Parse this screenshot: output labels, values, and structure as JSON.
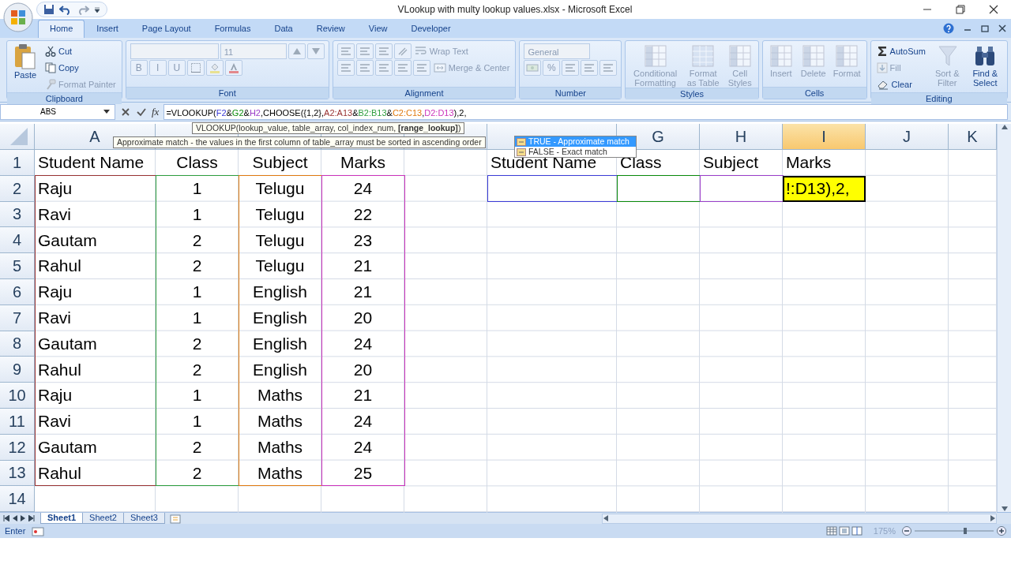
{
  "window": {
    "title": "VLookup with  multy lookup values.xlsx - Microsoft Excel"
  },
  "ribbon_tabs": [
    {
      "label": "Home",
      "selected": true
    },
    {
      "label": "Insert",
      "selected": false
    },
    {
      "label": "Page Layout",
      "selected": false
    },
    {
      "label": "Formulas",
      "selected": false
    },
    {
      "label": "Data",
      "selected": false
    },
    {
      "label": "Review",
      "selected": false
    },
    {
      "label": "View",
      "selected": false
    },
    {
      "label": "Developer",
      "selected": false
    }
  ],
  "ribbon": {
    "groups": [
      {
        "label": "Clipboard",
        "blocks": [
          {
            "kind": "large",
            "label": "Paste",
            "disabled": false
          },
          {
            "kind": "stack",
            "lines": [
              [
                {
                  "kind": "small",
                  "label": "Cut",
                  "disabled": false
                }
              ],
              [
                {
                  "kind": "small",
                  "label": "Copy",
                  "disabled": false
                }
              ],
              [
                {
                  "kind": "small",
                  "label": "Format Painter",
                  "disabled": true
                }
              ]
            ]
          }
        ]
      },
      {
        "label": "Font",
        "blocks": [
          {
            "kind": "stack",
            "lines": [
              [
                {
                  "kind": "field",
                  "disabled": true
                },
                {
                  "kind": "field",
                  "value": "11",
                  "disabled": true
                },
                {
                  "kind": "icon_button",
                  "disabled": true
                },
                {
                  "kind": "icon_button",
                  "disabled": true
                }
              ],
              [
                {
                  "kind": "text_button",
                  "label": "B",
                  "disabled": true
                },
                {
                  "kind": "text_button",
                  "label": "I",
                  "disabled": true
                },
                {
                  "kind": "text_button",
                  "label": "U",
                  "disabled": true
                },
                {
                  "kind": "icon_button",
                  "disabled": true
                },
                {
                  "kind": "icon_button",
                  "disabled": true
                },
                {
                  "kind": "icon_button",
                  "disabled": true
                }
              ]
            ]
          }
        ]
      },
      {
        "label": "Alignment",
        "blocks": [
          {
            "kind": "stack",
            "lines": [
              [
                {
                  "kind": "icon_button",
                  "disabled": true
                },
                {
                  "kind": "icon_button",
                  "disabled": true
                },
                {
                  "kind": "icon_button",
                  "disabled": true
                },
                {
                  "kind": "icon_button",
                  "disabled": true
                },
                {
                  "kind": "small",
                  "label": "Wrap Text",
                  "disabled": true
                }
              ],
              [
                {
                  "kind": "icon_button",
                  "disabled": true
                },
                {
                  "kind": "icon_button",
                  "disabled": true
                },
                {
                  "kind": "icon_button",
                  "disabled": true
                },
                {
                  "kind": "icon_button",
                  "disabled": true
                },
                {
                  "kind": "icon_button",
                  "disabled": true
                },
                {
                  "kind": "small",
                  "label": "Merge & Center",
                  "disabled": true
                }
              ]
            ]
          }
        ]
      },
      {
        "label": "Number",
        "blocks": [
          {
            "kind": "stack",
            "lines": [
              [
                {
                  "kind": "field",
                  "value": "General",
                  "disabled": true
                }
              ],
              [
                {
                  "kind": "icon_button",
                  "disabled": true
                },
                {
                  "kind": "text_button",
                  "label": "%",
                  "disabled": true
                },
                {
                  "kind": "icon_button",
                  "disabled": true
                },
                {
                  "kind": "icon_button",
                  "disabled": true
                },
                {
                  "kind": "icon_button",
                  "disabled": true
                }
              ]
            ]
          }
        ]
      },
      {
        "label": "Styles",
        "blocks": [
          {
            "kind": "large",
            "label": "Conditional Formatting",
            "disabled": true
          },
          {
            "kind": "large",
            "label": "Format as Table",
            "disabled": true
          },
          {
            "kind": "large",
            "label": "Cell Styles",
            "disabled": true
          }
        ]
      },
      {
        "label": "Cells",
        "blocks": [
          {
            "kind": "large",
            "label": "Insert",
            "disabled": true
          },
          {
            "kind": "large",
            "label": "Delete",
            "disabled": true
          },
          {
            "kind": "large",
            "label": "Format",
            "disabled": true
          }
        ]
      },
      {
        "label": "Editing",
        "blocks": [
          {
            "kind": "stack",
            "lines": [
              [
                {
                  "kind": "small",
                  "label": "AutoSum",
                  "disabled": false
                }
              ],
              [
                {
                  "kind": "small",
                  "label": "Fill",
                  "disabled": true
                }
              ],
              [
                {
                  "kind": "small",
                  "label": "Clear",
                  "disabled": false
                }
              ]
            ]
          },
          {
            "kind": "large",
            "label": "Sort & Filter",
            "disabled": true
          },
          {
            "kind": "large",
            "label": "Find & Select",
            "disabled": false
          }
        ]
      }
    ]
  },
  "formula_bar": {
    "name_box": "ABS",
    "function_label": "fx",
    "formula": [
      {
        "text": "=VLOOKUP("
      },
      {
        "text": "F2",
        "color": "#3c3cd6"
      },
      {
        "text": "&"
      },
      {
        "text": "G2",
        "color": "#0a8a0a"
      },
      {
        "text": "&"
      },
      {
        "text": "H2",
        "color": "#9b3fc9"
      },
      {
        "text": ",CHOOSE({1,2},"
      },
      {
        "text": "A2:A13",
        "color": "#993333"
      },
      {
        "text": "&"
      },
      {
        "text": "B2:B13",
        "color": "#2e9e3e"
      },
      {
        "text": "&"
      },
      {
        "text": "C2:C13",
        "color": "#e07a10"
      },
      {
        "text": ","
      },
      {
        "text": "D2:D13",
        "color": "#cc33bb"
      },
      {
        "text": "),2,"
      }
    ]
  },
  "function_tooltip": "VLOOKUP(lookup_value, table_array, col_index_num, **[range_lookup]**)",
  "argument_tooltip": "Approximate match - the values in the first column of table_array must be sorted in ascending order",
  "autocomplete": [
    {
      "label": "TRUE - Approximate match",
      "selected": true
    },
    {
      "label": "FALSE - Exact match",
      "selected": false
    }
  ],
  "column_headers": [
    {
      "label": "A",
      "selected": false
    },
    {
      "selected": false
    },
    {
      "selected": false
    },
    {
      "selected": false
    },
    {
      "selected": false
    },
    {
      "selected": false
    },
    {
      "label": "G",
      "selected": false
    },
    {
      "label": "H",
      "selected": false
    },
    {
      "label": "I",
      "selected": true
    },
    {
      "label": "J",
      "selected": false
    },
    {
      "label": "K",
      "selected": false
    }
  ],
  "row_numbers": [
    "1",
    "2",
    "3",
    "4",
    "5",
    "6",
    "7",
    "8",
    "9",
    "10",
    "11",
    "12",
    "13",
    "14"
  ],
  "data_table": {
    "headers": [
      "Student Name",
      "Class",
      "Subject",
      "Marks"
    ],
    "columns": [
      {
        "color": "#993333"
      },
      {
        "color": "#2e9e3e"
      },
      {
        "color": "#e07a10"
      },
      {
        "color": "#cc33bb"
      }
    ],
    "rows": [
      [
        "Raju",
        "1",
        "Telugu",
        "24"
      ],
      [
        "Ravi",
        "1",
        "Telugu",
        "22"
      ],
      [
        "Gautam",
        "2",
        "Telugu",
        "23"
      ],
      [
        "Rahul",
        "2",
        "Telugu",
        "21"
      ],
      [
        "Raju",
        "1",
        "English",
        "21"
      ],
      [
        "Ravi",
        "1",
        "English",
        "20"
      ],
      [
        "Gautam",
        "2",
        "English",
        "24"
      ],
      [
        "Rahul",
        "2",
        "English",
        "20"
      ],
      [
        "Raju",
        "1",
        "Maths",
        "21"
      ],
      [
        "Ravi",
        "1",
        "Maths",
        "24"
      ],
      [
        "Gautam",
        "2",
        "Maths",
        "24"
      ],
      [
        "Rahul",
        "2",
        "Maths",
        "25"
      ]
    ]
  },
  "lookup_table": {
    "columns": [
      {
        "header": "Student Name",
        "color": "#3c3cd6",
        "selected": false
      },
      {
        "header": "Class",
        "color": "#0a8a0a",
        "selected": false
      },
      {
        "header": "Subject",
        "color": "#9b3fc9",
        "selected": false
      },
      {
        "header": "Marks",
        "input": "!:D13),2,",
        "selected": true
      }
    ]
  },
  "sheet_tabs": [
    {
      "label": "Sheet1",
      "selected": true
    },
    {
      "label": "Sheet2",
      "selected": false
    },
    {
      "label": "Sheet3",
      "selected": false
    }
  ],
  "status_bar": {
    "mode": "Enter",
    "zoom": "175%"
  }
}
